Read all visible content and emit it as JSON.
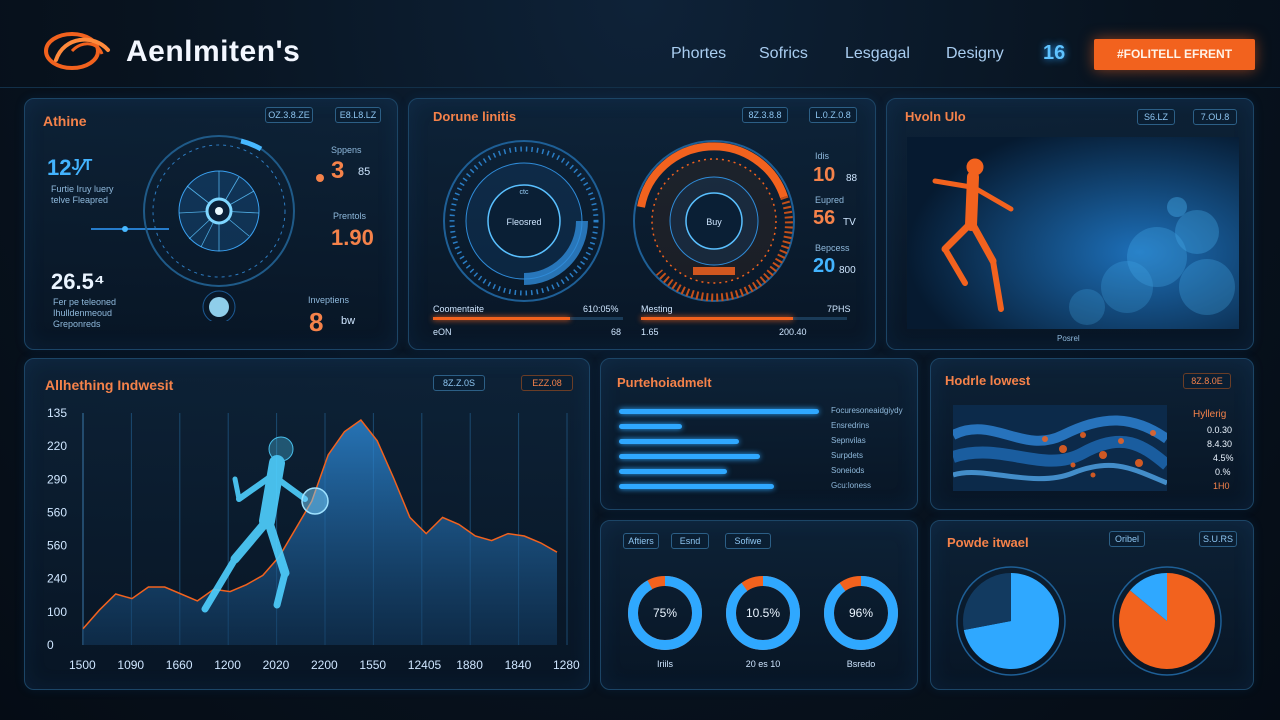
{
  "header": {
    "brand": "Aenlmiten's",
    "nav": [
      "Phortes",
      "Sofrics",
      "Lesgagal",
      "Designy"
    ],
    "nav_number": "16",
    "cta_label": "#FOLITELL EFRENT"
  },
  "panel_athlete": {
    "title": "Athine",
    "chips": [
      "OZ.3.8.ZE",
      "E8.L8.LZ"
    ],
    "left_big": "12ᴶ⁄ᵀ",
    "left_desc": "Furtie Iruy luery\ntelve Fleapred",
    "left_big2": "26.5⁴",
    "left_desc2": "Fer pe teleoned\nIhulldenmeoud\nGreponreds",
    "stat1_label": "Sppens",
    "stat1_value": "3",
    "stat1_unit": "85",
    "stat2_label": "Prentols",
    "stat2_value": "1.90",
    "stat3_label": "Inveptiens",
    "stat3_value": "8",
    "stat3_unit": "bw"
  },
  "panel_gauges": {
    "title": "Dorune linitis",
    "chips": [
      "8Z.3.8.8",
      "L.0.Z.0.8"
    ],
    "gauge1_label": "Fleosred",
    "gauge1_top": "ctc",
    "gauge2_label": "Buy",
    "stat1_label": "Idis",
    "stat1_value": "10",
    "stat1_unit": "88",
    "stat2_label": "Eupred",
    "stat2_value": "56",
    "stat2_unit": "TV",
    "stat3_label": "Bepcess",
    "stat3_value": "20",
    "stat3_unit": "800",
    "bar1_label": "Coomentaite",
    "bar1_right": "610:05%",
    "bar1_foot_l": "eON",
    "bar1_foot_r": "68",
    "bar1_level": 0.72,
    "bar2_label": "Mesting",
    "bar2_right": "7PHS",
    "bar2_foot_l": "1.65",
    "bar2_foot_r": "200.40",
    "bar2_level": 0.74
  },
  "panel_video": {
    "title": "Hvoln Ulo",
    "chips": [
      "S6.LZ",
      "7.OU.8"
    ],
    "caption": "Posrel"
  },
  "panel_area": {
    "title": "Allhething Indwesit",
    "chips": [
      "8Z.Z.0S",
      "EZZ.08"
    ]
  },
  "chart_data": {
    "type": "area",
    "y_ticks": [
      "135",
      "220",
      "290",
      "560",
      "560",
      "240",
      "100",
      "0"
    ],
    "x_ticks": [
      "1500",
      "1090",
      "1660",
      "1200",
      "2020",
      "2200",
      "1550",
      "12405",
      "1880",
      "1840",
      "1280"
    ],
    "values": [
      0.07,
      0.15,
      0.22,
      0.2,
      0.25,
      0.25,
      0.22,
      0.19,
      0.24,
      0.23,
      0.26,
      0.3,
      0.38,
      0.5,
      0.62,
      0.82,
      0.92,
      0.97,
      0.88,
      0.72,
      0.55,
      0.48,
      0.55,
      0.52,
      0.47,
      0.45,
      0.48,
      0.47,
      0.44,
      0.4
    ],
    "grid": true
  },
  "panel_bars": {
    "title": "Purtehoiadmelt",
    "items": [
      {
        "label": "Focuresoneaidgiydy",
        "value": 0.98
      },
      {
        "label": "Ensredrins",
        "value": 0.31
      },
      {
        "label": "Sepnvilas",
        "value": 0.59
      },
      {
        "label": "Surpdets",
        "value": 0.69
      },
      {
        "label": "Soneiods",
        "value": 0.53
      },
      {
        "label": "Gcu:loness",
        "value": 0.76
      }
    ]
  },
  "panel_heatmap": {
    "title": "Hodrle lowest",
    "chip": "8Z.8.0E",
    "side_label": "Hyllerig",
    "values": [
      "0.0.30",
      "8.4.30",
      "4.5%",
      "0.%",
      "1H0"
    ]
  },
  "panel_donuts": {
    "chips": [
      "Aftiers",
      "Esnd",
      "Sofiwe"
    ],
    "donuts": [
      {
        "value": "75%",
        "label": "Iriils",
        "fill": 0.92
      },
      {
        "value": "10.5%",
        "label": "20 es 10",
        "fill": 0.9
      },
      {
        "value": "96%",
        "label": "Bsredo",
        "fill": 0.9
      }
    ]
  },
  "panel_pies": {
    "title": "Powde itwael",
    "chips": [
      "Oribel",
      "S.U.RS"
    ],
    "pie1_share": 0.72,
    "pie2_share": 0.86
  }
}
